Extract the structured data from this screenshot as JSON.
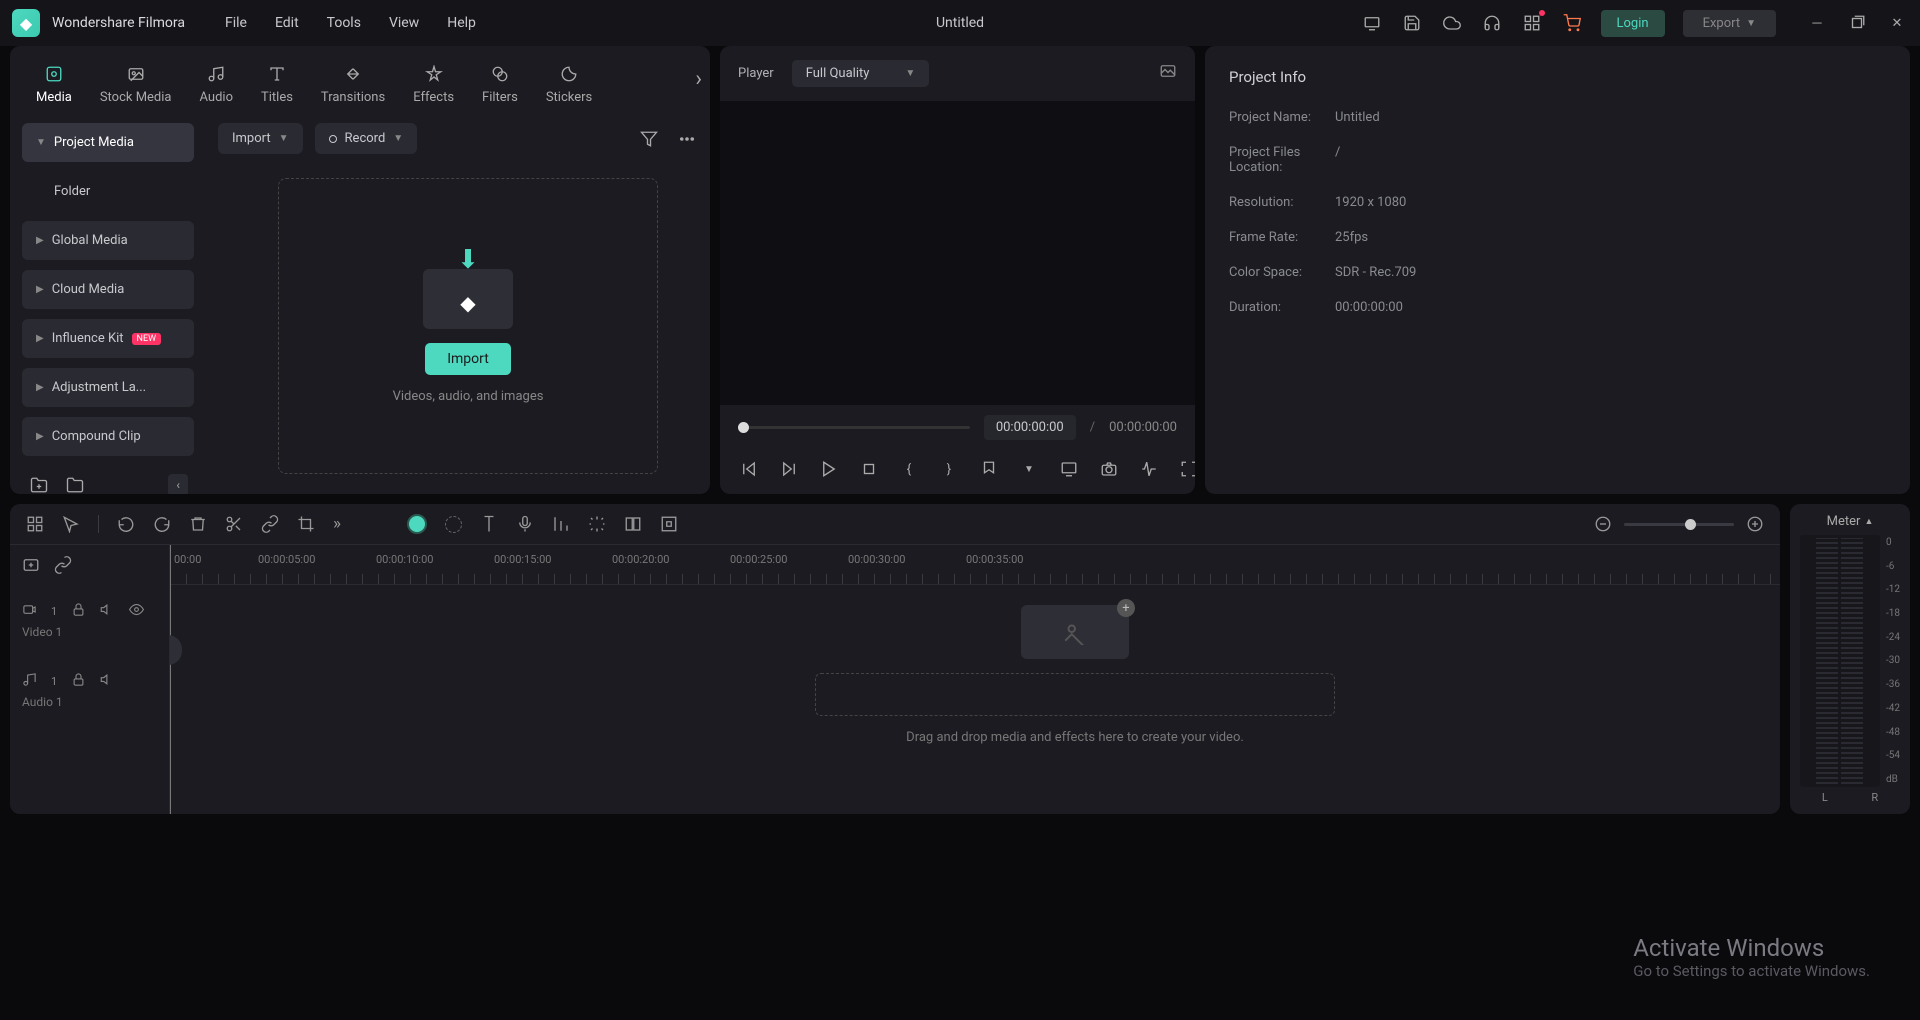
{
  "app": {
    "name": "Wondershare Filmora",
    "document_title": "Untitled"
  },
  "menu": {
    "file": "File",
    "edit": "Edit",
    "tools": "Tools",
    "view": "View",
    "help": "Help"
  },
  "titlebar": {
    "login": "Login",
    "export": "Export"
  },
  "media_tabs": {
    "media": "Media",
    "stock": "Stock Media",
    "audio": "Audio",
    "titles": "Titles",
    "transitions": "Transitions",
    "effects": "Effects",
    "filters": "Filters",
    "stickers": "Stickers"
  },
  "sidebar": {
    "project_media": "Project Media",
    "folder": "Folder",
    "global_media": "Global Media",
    "cloud_media": "Cloud Media",
    "influence_kit": "Influence Kit",
    "influence_badge": "NEW",
    "adjustment_layer": "Adjustment La...",
    "compound_clip": "Compound Clip"
  },
  "media_toolbar": {
    "import": "Import",
    "record": "Record"
  },
  "dropzone": {
    "button": "Import",
    "hint": "Videos, audio, and images"
  },
  "preview": {
    "player_label": "Player",
    "quality": "Full Quality",
    "current_time": "00:00:00:00",
    "separator": "/",
    "total_time": "00:00:00:00"
  },
  "project_info": {
    "title": "Project Info",
    "rows": {
      "name_label": "Project Name:",
      "name_value": "Untitled",
      "location_label": "Project Files Location:",
      "location_value": "/",
      "resolution_label": "Resolution:",
      "resolution_value": "1920 x 1080",
      "framerate_label": "Frame Rate:",
      "framerate_value": "25fps",
      "colorspace_label": "Color Space:",
      "colorspace_value": "SDR - Rec.709",
      "duration_label": "Duration:",
      "duration_value": "00:00:00:00"
    }
  },
  "timeline": {
    "ruler": [
      "00:00",
      "00:00:05:00",
      "00:00:10:00",
      "00:00:15:00",
      "00:00:20:00",
      "00:00:25:00",
      "00:00:30:00",
      "00:00:35:00"
    ],
    "video_track": "Video 1",
    "audio_track": "Audio 1",
    "video_num": "1",
    "audio_num": "1",
    "drop_hint": "Drag and drop media and effects here to create your video."
  },
  "meter": {
    "title": "Meter",
    "scale": [
      "0",
      "-6",
      "-12",
      "-18",
      "-24",
      "-30",
      "-36",
      "-42",
      "-48",
      "-54",
      "dB"
    ],
    "left": "L",
    "right": "R"
  },
  "watermark": {
    "title": "Activate Windows",
    "subtitle": "Go to Settings to activate Windows."
  }
}
